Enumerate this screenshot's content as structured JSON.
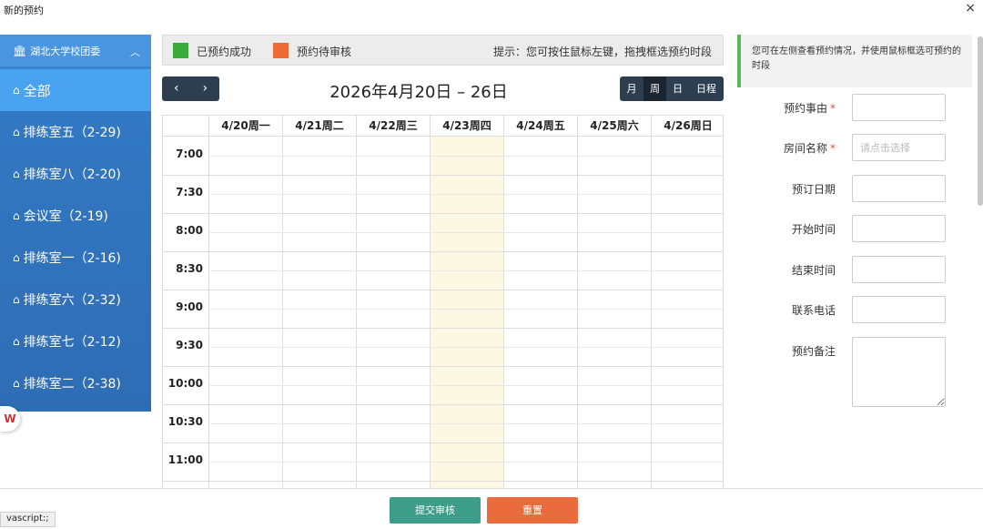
{
  "window": {
    "title": "新的预约",
    "close_glyph": "×"
  },
  "sidebar": {
    "header": "湖北大学校团委",
    "items": [
      {
        "label": "全部",
        "active": true
      },
      {
        "label": "排练室五（2-29)"
      },
      {
        "label": "排练室八（2-20)"
      },
      {
        "label": "会议室（2-19)"
      },
      {
        "label": "排练室一（2-16)"
      },
      {
        "label": "排练室六（2-32)"
      },
      {
        "label": "排练室七（2-12)"
      },
      {
        "label": "排练室二（2-38)"
      }
    ]
  },
  "legend": {
    "success": {
      "label": "已预约成功",
      "color": "#3aab3a"
    },
    "pending": {
      "label": "预约待审核",
      "color": "#ee6a35"
    },
    "hint": "提示：您可按住鼠标左键，拖拽框选预约时段"
  },
  "toolbar": {
    "prev": "‹",
    "next": "›",
    "date_range": "2026年4月20日 – 26日",
    "views": [
      "月",
      "周",
      "日",
      "日程"
    ],
    "active_view": "周"
  },
  "calendar": {
    "days": [
      "4/20周一",
      "4/21周二",
      "4/22周三",
      "4/23周四",
      "4/24周五",
      "4/25周六",
      "4/26周日"
    ],
    "today_index": 3,
    "times": [
      "7:00",
      "7:30",
      "8:00",
      "8:30",
      "9:00",
      "9:30",
      "10:00",
      "10:30",
      "11:00"
    ]
  },
  "panel": {
    "tip": "您可在左侧查看预约情况，并使用鼠标框选可预约的时段",
    "fields": [
      {
        "label": "预约事由",
        "required": true,
        "placeholder": ""
      },
      {
        "label": "房间名称",
        "required": true,
        "placeholder": "请点击选择"
      },
      {
        "label": "预订日期",
        "required": false,
        "placeholder": ""
      },
      {
        "label": "开始时间",
        "required": false,
        "placeholder": ""
      },
      {
        "label": "结束时间",
        "required": false,
        "placeholder": ""
      },
      {
        "label": "联系电话",
        "required": false,
        "placeholder": ""
      },
      {
        "label": "预约备注",
        "required": false,
        "placeholder": ""
      }
    ]
  },
  "footer": {
    "submit": "提交审核",
    "reset": "重置"
  },
  "status_bar": "vascript:;"
}
